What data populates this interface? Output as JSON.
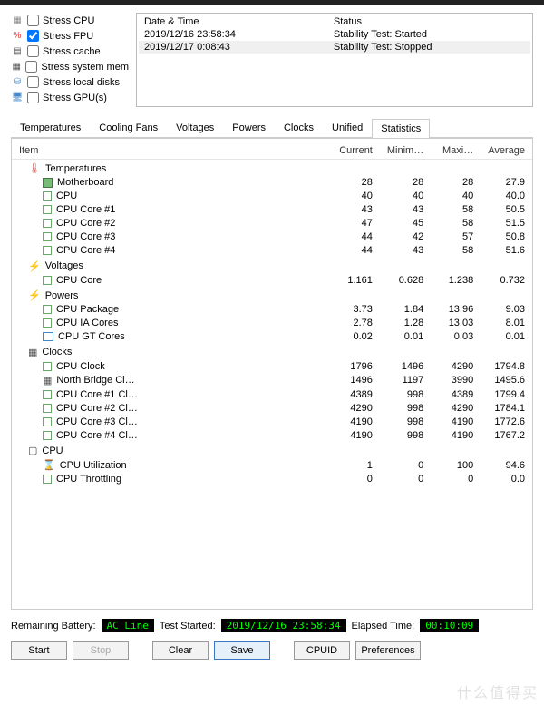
{
  "stress": [
    {
      "icon": "▦",
      "color": "#888",
      "label": "Stress CPU",
      "checked": false
    },
    {
      "icon": "%",
      "color": "#d33",
      "label": "Stress FPU",
      "checked": true
    },
    {
      "icon": "▤",
      "color": "#555",
      "label": "Stress cache",
      "checked": false
    },
    {
      "icon": "▦",
      "color": "#555",
      "label": "Stress system mem",
      "checked": false
    },
    {
      "icon": "⛁",
      "color": "#48c",
      "label": "Stress local disks",
      "checked": false
    },
    {
      "icon": "🖥",
      "color": "#48c",
      "label": "Stress GPU(s)",
      "checked": false
    }
  ],
  "log": {
    "headers": {
      "dt": "Date & Time",
      "st": "Status"
    },
    "rows": [
      {
        "dt": "2019/12/16 23:58:34",
        "st": "Stability Test: Started",
        "sel": false
      },
      {
        "dt": "2019/12/17 0:08:43",
        "st": "Stability Test: Stopped",
        "sel": true
      }
    ]
  },
  "tabs": [
    "Temperatures",
    "Cooling Fans",
    "Voltages",
    "Powers",
    "Clocks",
    "Unified",
    "Statistics"
  ],
  "active_tab": 6,
  "columns": {
    "item": "Item",
    "cur": "Current",
    "min": "Minim…",
    "max": "Maxi…",
    "avg": "Average"
  },
  "groups": [
    {
      "name": "Temperatures",
      "icon": "therm",
      "rows": [
        {
          "icon": "chip",
          "name": "Motherboard",
          "cur": "28",
          "min": "28",
          "max": "28",
          "avg": "27.9"
        },
        {
          "icon": "sq",
          "name": "CPU",
          "cur": "40",
          "min": "40",
          "max": "40",
          "avg": "40.0"
        },
        {
          "icon": "sq",
          "name": "CPU Core #1",
          "cur": "43",
          "min": "43",
          "max": "58",
          "avg": "50.5"
        },
        {
          "icon": "sq",
          "name": "CPU Core #2",
          "cur": "47",
          "min": "45",
          "max": "58",
          "avg": "51.5"
        },
        {
          "icon": "sq",
          "name": "CPU Core #3",
          "cur": "44",
          "min": "42",
          "max": "57",
          "avg": "50.8"
        },
        {
          "icon": "sq",
          "name": "CPU Core #4",
          "cur": "44",
          "min": "43",
          "max": "58",
          "avg": "51.6"
        }
      ]
    },
    {
      "name": "Voltages",
      "icon": "volt",
      "rows": [
        {
          "icon": "sq",
          "name": "CPU Core",
          "cur": "1.161",
          "min": "0.628",
          "max": "1.238",
          "avg": "0.732"
        }
      ]
    },
    {
      "name": "Powers",
      "icon": "pow",
      "rows": [
        {
          "icon": "sq",
          "name": "CPU Package",
          "cur": "3.73",
          "min": "1.84",
          "max": "13.96",
          "avg": "9.03"
        },
        {
          "icon": "sq",
          "name": "CPU IA Cores",
          "cur": "2.78",
          "min": "1.28",
          "max": "13.03",
          "avg": "8.01"
        },
        {
          "icon": "mon",
          "name": "CPU GT Cores",
          "cur": "0.02",
          "min": "0.01",
          "max": "0.03",
          "avg": "0.01"
        }
      ]
    },
    {
      "name": "Clocks",
      "icon": "clock",
      "rows": [
        {
          "icon": "sq",
          "name": "CPU Clock",
          "cur": "1796",
          "min": "1496",
          "max": "4290",
          "avg": "1794.8"
        },
        {
          "icon": "clock",
          "name": "North Bridge Cl…",
          "cur": "1496",
          "min": "1197",
          "max": "3990",
          "avg": "1495.6"
        },
        {
          "icon": "sq",
          "name": "CPU Core #1 Cl…",
          "cur": "4389",
          "min": "998",
          "max": "4389",
          "avg": "1799.4"
        },
        {
          "icon": "sq",
          "name": "CPU Core #2 Cl…",
          "cur": "4290",
          "min": "998",
          "max": "4290",
          "avg": "1784.1"
        },
        {
          "icon": "sq",
          "name": "CPU Core #3 Cl…",
          "cur": "4190",
          "min": "998",
          "max": "4190",
          "avg": "1772.6"
        },
        {
          "icon": "sq",
          "name": "CPU Core #4 Cl…",
          "cur": "4190",
          "min": "998",
          "max": "4190",
          "avg": "1767.2"
        }
      ]
    },
    {
      "name": "CPU",
      "icon": "cpu",
      "rows": [
        {
          "icon": "hour",
          "name": "CPU Utilization",
          "cur": "1",
          "min": "0",
          "max": "100",
          "avg": "94.6"
        },
        {
          "icon": "sq",
          "name": "CPU Throttling",
          "cur": "0",
          "min": "0",
          "max": "0",
          "avg": "0.0"
        }
      ]
    }
  ],
  "status": {
    "battery_label": "Remaining Battery:",
    "battery_val": "AC Line",
    "start_label": "Test Started:",
    "start_val": "2019/12/16 23:58:34",
    "elapsed_label": "Elapsed Time:",
    "elapsed_val": "00:10:09"
  },
  "buttons": {
    "start": "Start",
    "stop": "Stop",
    "clear": "Clear",
    "save": "Save",
    "cpuid": "CPUID",
    "prefs": "Preferences"
  },
  "watermark": "什么值得买"
}
